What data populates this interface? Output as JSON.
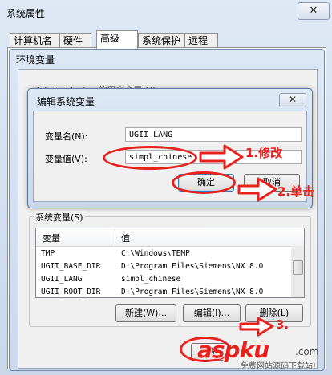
{
  "outer": {
    "title": "系统属性",
    "close": "✕"
  },
  "tabs": [
    {
      "label": "计算机名"
    },
    {
      "label": "硬件"
    },
    {
      "label": "高级"
    },
    {
      "label": "系统保护"
    },
    {
      "label": "远程"
    }
  ],
  "env": {
    "title": "环境变量",
    "user_vars_header": "Administrator 的用户变量(U)"
  },
  "edit": {
    "title": "编辑系统变量",
    "close": "✕",
    "name_label": "变量名(N):",
    "name_value": "UGII_LANG",
    "value_label": "变量值(V):",
    "value_value": "simpl_chinese",
    "ok": "确定",
    "cancel": "取消"
  },
  "sys": {
    "header": "系统变量(S)",
    "columns": [
      "变量",
      "值"
    ],
    "rows": [
      {
        "name": "TMP",
        "value": "C:\\Windows\\TEMP"
      },
      {
        "name": "UGII_BASE_DIR",
        "value": "D:\\Program Files\\Siemens\\NX 8.0"
      },
      {
        "name": "UGII_LANG",
        "value": "simpl_chinese"
      },
      {
        "name": "UGII_ROOT_DIR",
        "value": "D:\\Program Files\\Siemens\\NX 8.0"
      }
    ],
    "new_button": "新建(W)...",
    "edit_button": "编辑(I)...",
    "delete_button": "删除(L)"
  },
  "bottom": {
    "ok_partial": "确"
  },
  "annotations": {
    "step1": "1.修改",
    "step2": "2.单击",
    "step3": "3."
  },
  "watermark": {
    "brand": "aspku",
    "suffix": ".com",
    "slogan": "免费网站源码下载站!"
  },
  "colors": {
    "annotation_red": "#e8211c",
    "window_blue": "#cbd9ea"
  }
}
